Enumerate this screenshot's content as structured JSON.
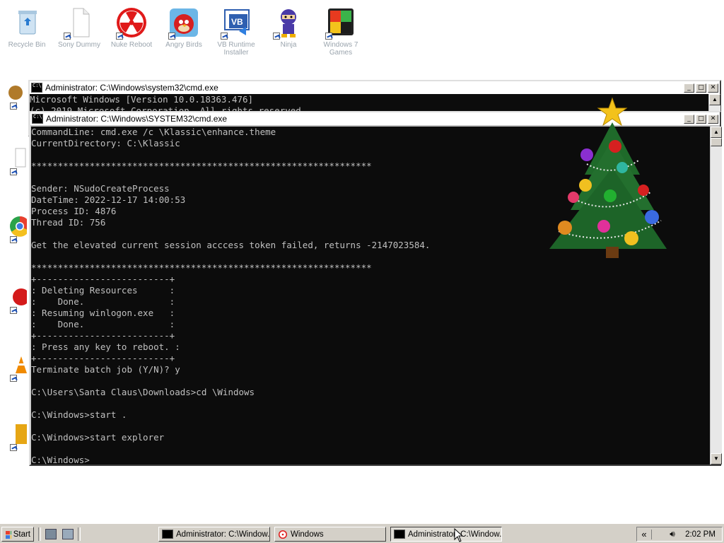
{
  "desktop": {
    "icons": [
      {
        "name": "recycle-bin-icon",
        "label": "Recycle Bin"
      },
      {
        "name": "sony-dummy-icon",
        "label": "Sony Dummy"
      },
      {
        "name": "radiation-app-icon",
        "label": "Nuke Reboot"
      },
      {
        "name": "angry-birds-icon",
        "label": "Angry Birds"
      },
      {
        "name": "vb-icon",
        "label": "VB Runtime Installer"
      },
      {
        "name": "ninja-icon",
        "label": "Ninja"
      },
      {
        "name": "colorful-app-icon",
        "label": "Windows 7 Games"
      }
    ]
  },
  "window_back": {
    "title": "Administrator: C:\\Windows\\system32\\cmd.exe",
    "lines": [
      "Microsoft Windows [Version 10.0.18363.476]",
      "(c) 2019 Microsoft Corporation. All rights reserved."
    ]
  },
  "window_front": {
    "title": "Administrator: C:\\Windows\\SYSTEM32\\cmd.exe",
    "lines": [
      "CommandLine: cmd.exe /c \\Klassic\\enhance.theme",
      "CurrentDirectory: C:\\Klassic",
      "",
      "****************************************************************",
      "",
      "Sender: NSudoCreateProcess",
      "DateTime: 2022-12-17 14:00:53",
      "Process ID: 4876",
      "Thread ID: 756",
      "",
      "Get the elevated current session acccess token failed, returns -2147023584.",
      "",
      "****************************************************************",
      "+-------------------------+",
      ": Deleting Resources      :",
      ":    Done.                :",
      ": Resuming winlogon.exe   :",
      ":    Done.                :",
      "+-------------------------+",
      ": Press any key to reboot. :",
      "+-------------------------+",
      "Terminate batch job (Y/N)? y",
      "",
      "C:\\Users\\Santa Claus\\Downloads>cd \\Windows",
      "",
      "C:\\Windows>start .",
      "",
      "C:\\Windows>start explorer",
      "",
      "C:\\Windows>"
    ]
  },
  "taskbar": {
    "start_label": "Start",
    "buttons": [
      {
        "label": "Administrator: C:\\Window...",
        "icon": "cmd-icon"
      },
      {
        "label": "Windows",
        "icon": "radiation-app-icon"
      },
      {
        "label": "Administrator: C:\\Window...",
        "icon": "cmd-icon",
        "active": true
      }
    ],
    "clock": "2:02 PM"
  },
  "colors": {
    "console_bg": "#0c0c0c",
    "console_text": "#c0c0c0",
    "window_frame": "#c0c0c0",
    "taskbar": "#d4d0c8"
  }
}
